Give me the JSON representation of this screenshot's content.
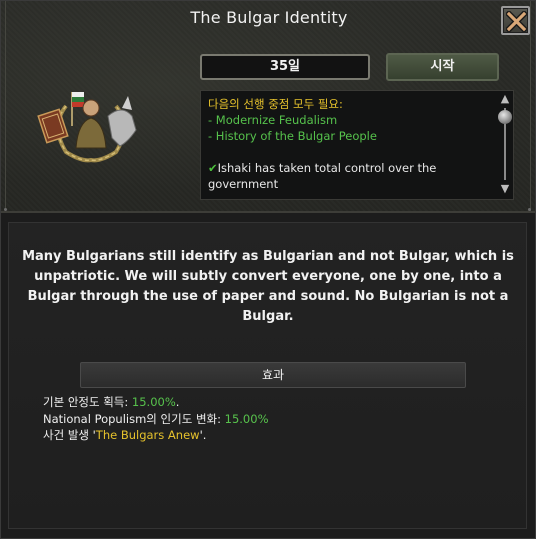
{
  "window": {
    "title": "The Bulgar Identity",
    "close_icon": "close-x-icon"
  },
  "focus": {
    "days": "35일",
    "start_label": "시작",
    "emblem_icon": "bulgar-focus-emblem-icon"
  },
  "requirements": {
    "title": "다음의 선행 중점 모두 필요:",
    "items": [
      "- Modernize Feudalism",
      "- History of the Bulgar People"
    ],
    "completed_check": "✔",
    "completed_text": "Ishaki has taken total control over the government"
  },
  "description": "Many Bulgarians still identify as Bulgarian and not Bulgar, which is unpatriotic. We will subtly convert everyone, one by one, into a Bulgar through the use of paper and sound. No Bulgarian is not a Bulgar.",
  "effects": {
    "header": "효과",
    "line1_label": "기본 안정도 획득: ",
    "line1_value": "15.00%",
    "line1_end": ".",
    "line2_label": "National Populism의 인기도 변화: ",
    "line2_value": "15.00%",
    "line3_prefix": "사건 발생 '",
    "line3_event": "The Bulgars Anew",
    "line3_suffix": "'."
  },
  "colors": {
    "accent_gold": "#e6c22c",
    "accent_green": "#57c24c",
    "start_button": "#4f5a45"
  }
}
